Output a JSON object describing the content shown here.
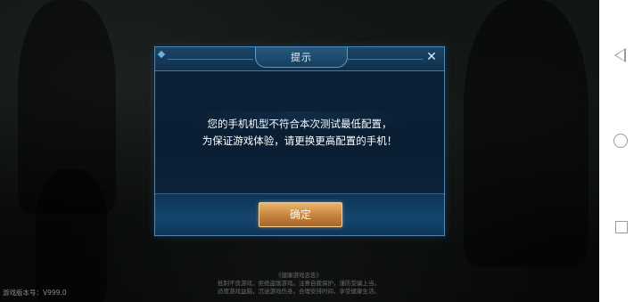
{
  "dialog": {
    "title": "提示",
    "close_label": "✕",
    "message_lines": [
      "您的手机机型不符合本次测试最低配置，",
      "为保证游戏体验，请更换更高配置的手机！"
    ],
    "confirm_label": "确定"
  },
  "footer": {
    "version": "游戏版本号：V999.0",
    "health_notice": [
      "《健康游戏忠告》",
      "抵制不良游戏，拒绝盗版游戏。注意自我保护，谨防受骗上当。",
      "适度游戏益脑，沉迷游戏伤身。合理安排时间，享受健康生活。"
    ]
  },
  "nav": {
    "icons": [
      "back-icon",
      "home-icon",
      "recent-apps-icon"
    ]
  },
  "colors": {
    "dialog_border": "#4f86b3",
    "dialog_bg": "#0a1e33",
    "confirm_button": "#c98640",
    "nav_bg": "#ffffff"
  }
}
